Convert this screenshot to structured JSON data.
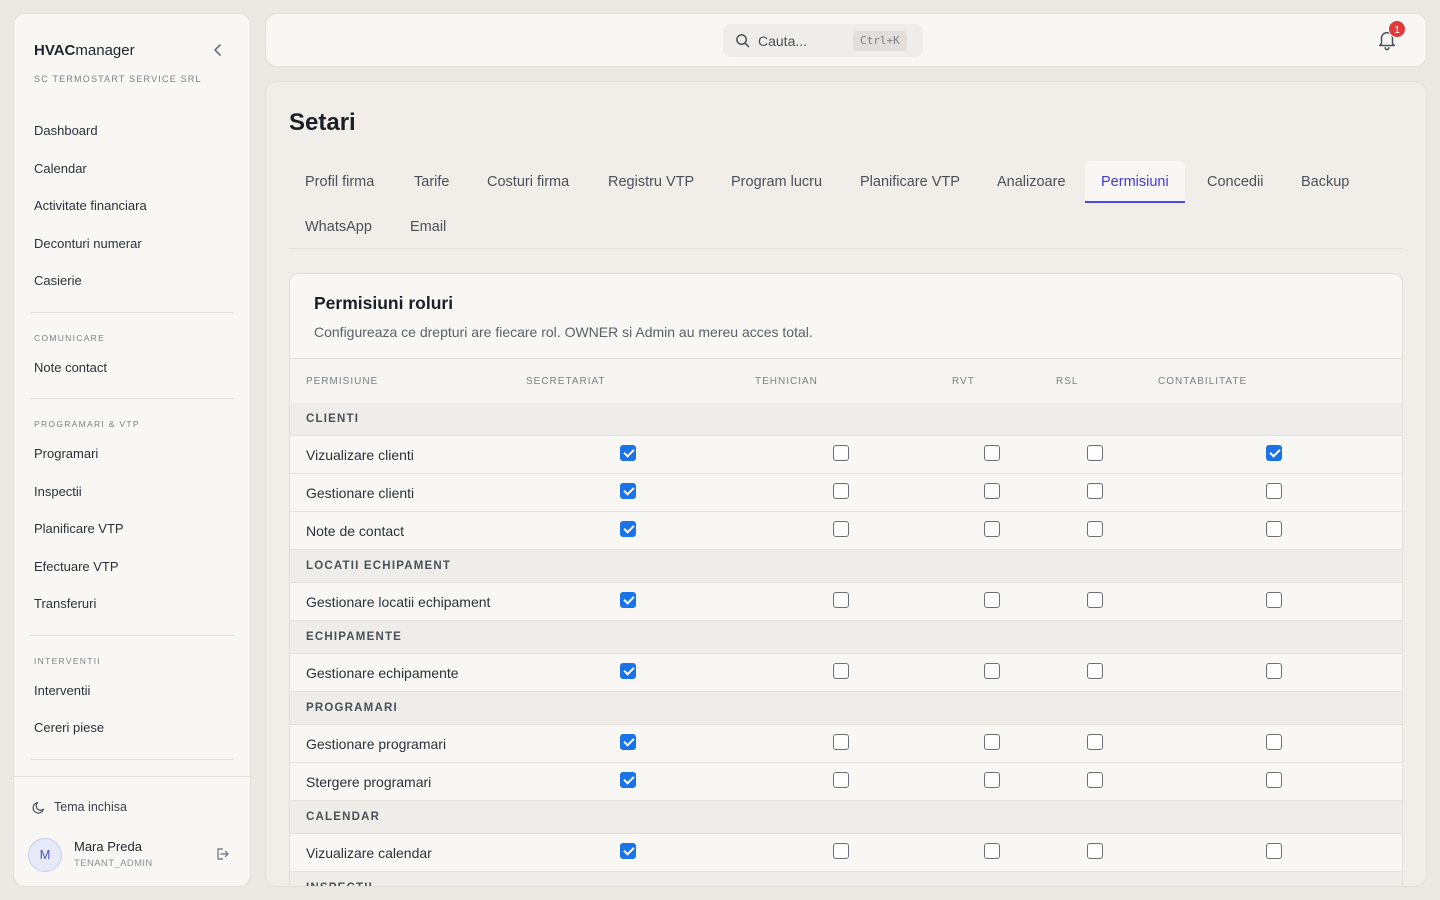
{
  "brand": {
    "bold": "HVAC",
    "light": "manager"
  },
  "company": "SC TERMOSTART SERVICE SRL",
  "nav": {
    "main": [
      "Dashboard",
      "Calendar",
      "Activitate financiara",
      "Deconturi numerar",
      "Casierie"
    ],
    "comunicare_title": "COMUNICARE",
    "comunicare": [
      "Note contact"
    ],
    "programari_title": "PROGRAMARI & VTP",
    "programari": [
      "Programari",
      "Inspectii",
      "Planificare VTP",
      "Efectuare VTP",
      "Transferuri"
    ],
    "interventii_title": "INTERVENTII",
    "interventii": [
      "Interventii",
      "Cereri piese"
    ]
  },
  "theme_label": "Tema inchisa",
  "user": {
    "initial": "M",
    "name": "Mara Preda",
    "role": "TENANT_ADMIN"
  },
  "search": {
    "placeholder": "Cauta...",
    "shortcut": "Ctrl+K"
  },
  "notifications": {
    "count": "1"
  },
  "page_title": "Setari",
  "tabs": [
    "Profil firma",
    "Tarife",
    "Costuri firma",
    "Registru VTP",
    "Program lucru",
    "Planificare VTP",
    "Analizoare",
    "Permisiuni",
    "Concedii",
    "Backup",
    "WhatsApp",
    "Email"
  ],
  "active_tab": "Permisiuni",
  "card": {
    "title": "Permisiuni roluri",
    "subtitle": "Configureaza ce drepturi are fiecare rol. OWNER si Admin au mereu acces total."
  },
  "table": {
    "headers": [
      "PERMISIUNE",
      "SECRETARIAT",
      "TEHNICIAN",
      "RVT",
      "RSL",
      "CONTABILITATE"
    ],
    "groups": [
      {
        "name": "CLIENTI",
        "rows": [
          {
            "label": "Vizualizare clienti",
            "values": [
              true,
              false,
              false,
              false,
              true
            ]
          },
          {
            "label": "Gestionare clienti",
            "values": [
              true,
              false,
              false,
              false,
              false
            ]
          },
          {
            "label": "Note de contact",
            "values": [
              true,
              false,
              false,
              false,
              false
            ]
          }
        ]
      },
      {
        "name": "LOCATII ECHIPAMENT",
        "rows": [
          {
            "label": "Gestionare locatii echipament",
            "values": [
              true,
              false,
              false,
              false,
              false
            ]
          }
        ]
      },
      {
        "name": "ECHIPAMENTE",
        "rows": [
          {
            "label": "Gestionare echipamente",
            "values": [
              true,
              false,
              false,
              false,
              false
            ]
          }
        ]
      },
      {
        "name": "PROGRAMARI",
        "rows": [
          {
            "label": "Gestionare programari",
            "values": [
              true,
              false,
              false,
              false,
              false
            ]
          },
          {
            "label": "Stergere programari",
            "values": [
              true,
              false,
              false,
              false,
              false
            ]
          }
        ]
      },
      {
        "name": "CALENDAR",
        "rows": [
          {
            "label": "Vizualizare calendar",
            "values": [
              true,
              false,
              false,
              false,
              false
            ]
          }
        ]
      },
      {
        "name": "INSPECTII",
        "rows": []
      }
    ]
  }
}
